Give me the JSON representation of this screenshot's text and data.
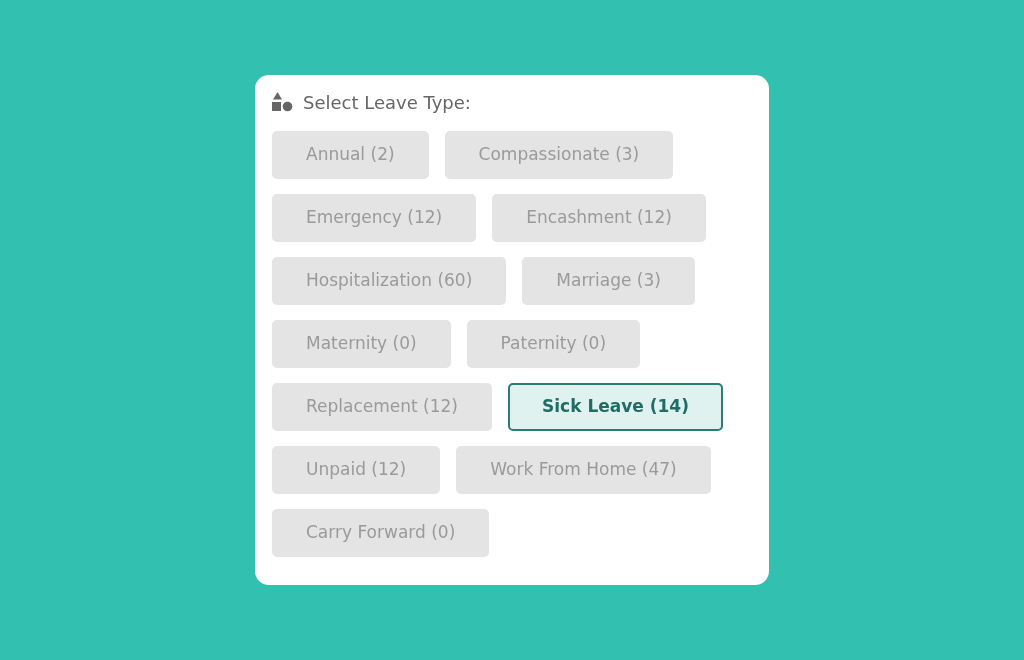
{
  "title": "Select Leave Type:",
  "leave_rows": [
    [
      {
        "label": "Annual (2)",
        "selected": false
      },
      {
        "label": "Compassionate (3)",
        "selected": false
      }
    ],
    [
      {
        "label": "Emergency (12)",
        "selected": false
      },
      {
        "label": "Encashment (12)",
        "selected": false
      }
    ],
    [
      {
        "label": "Hospitalization (60)",
        "selected": false
      },
      {
        "label": "Marriage (3)",
        "selected": false
      }
    ],
    [
      {
        "label": "Maternity (0)",
        "selected": false
      },
      {
        "label": "Paternity (0)",
        "selected": false
      }
    ],
    [
      {
        "label": "Replacement (12)",
        "selected": false
      },
      {
        "label": "Sick Leave (14)",
        "selected": true
      }
    ],
    [
      {
        "label": "Unpaid (12)",
        "selected": false
      },
      {
        "label": "Work From Home (47)",
        "selected": false
      }
    ],
    [
      {
        "label": "Carry Forward (0)",
        "selected": false
      }
    ]
  ]
}
